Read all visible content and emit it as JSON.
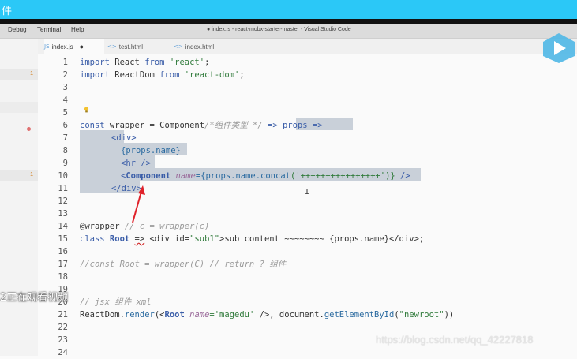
{
  "banner": {
    "text": "件"
  },
  "titlebar": {
    "menus": [
      "Debug",
      "Terminal",
      "Help"
    ],
    "window_title": "● index.js - react-mobx-starter-master - Visual Studio Code"
  },
  "sidebar": {
    "badges": [
      "1",
      "1"
    ]
  },
  "tabs": [
    {
      "label": "index.js",
      "icon": "JS",
      "modified": "●"
    },
    {
      "label": "test.html",
      "icon": "<>",
      "modified": ""
    },
    {
      "label": "index.html",
      "icon": "<>",
      "modified": ""
    }
  ],
  "line_numbers": [
    "1",
    "2",
    "3",
    "4",
    "5",
    "6",
    "7",
    "8",
    "9",
    "10",
    "11",
    "12",
    "13",
    "14",
    "15",
    "16",
    "17",
    "18",
    "19",
    "20",
    "21",
    "22",
    "23",
    "24"
  ],
  "code": {
    "l1": {
      "a": "import",
      "b": " React ",
      "c": "from",
      "d": " 'react'",
      "e": ";"
    },
    "l2": {
      "a": "import",
      "b": " ReactDom ",
      "c": "from",
      "d": " 'react-dom'",
      "e": ";"
    },
    "l6": {
      "a": "const",
      "b": " wrapper = ",
      "c": "Component",
      "d": "/*组件类型 */",
      "e": " => ",
      "f": "props =>"
    },
    "l7": {
      "a": "<div>"
    },
    "l8": {
      "a": "{props.name}"
    },
    "l9": {
      "a": "<hr />"
    },
    "l10": {
      "a": "<",
      "b": "Component",
      "c": " name",
      "d": "={props.name.",
      "e": "concat",
      "f": "('++++++++++++++++')}",
      "g": " />"
    },
    "l11": {
      "a": "</div>"
    },
    "l14": {
      "a": "@wrapper",
      "b": " // c = wrapper(c)"
    },
    "l15": {
      "a": "class",
      "b": " Root ",
      "c": "=>",
      "d": " <div id=",
      "e": "\"sub1\"",
      "f": ">sub content ~~~~~~~~ {props.name}</div>;"
    },
    "l17": {
      "a": "//const Root = wrapper(C) // return ? 组件"
    },
    "l20": {
      "a": "// jsx 组件 xml"
    },
    "l21": {
      "a": "ReactDom",
      "b": ".",
      "c": "render",
      "d": "(<",
      "e": "Root",
      "f": " name",
      "g": "='magedu'",
      "h": " />, document.",
      "i": "getElementById",
      "j": "(",
      "k": "\"newroot\"",
      "l": "))"
    }
  },
  "overlay": {
    "text": "2正在观看视频"
  },
  "watermark": {
    "text": "https://blog.csdn.net/qq_42227818"
  },
  "colors": {
    "banner": "#2bc8f7",
    "keyword": "#3a5da8",
    "string": "#2f7a3a",
    "arrow": "#e0222a",
    "selection": "#c9d0d9"
  }
}
